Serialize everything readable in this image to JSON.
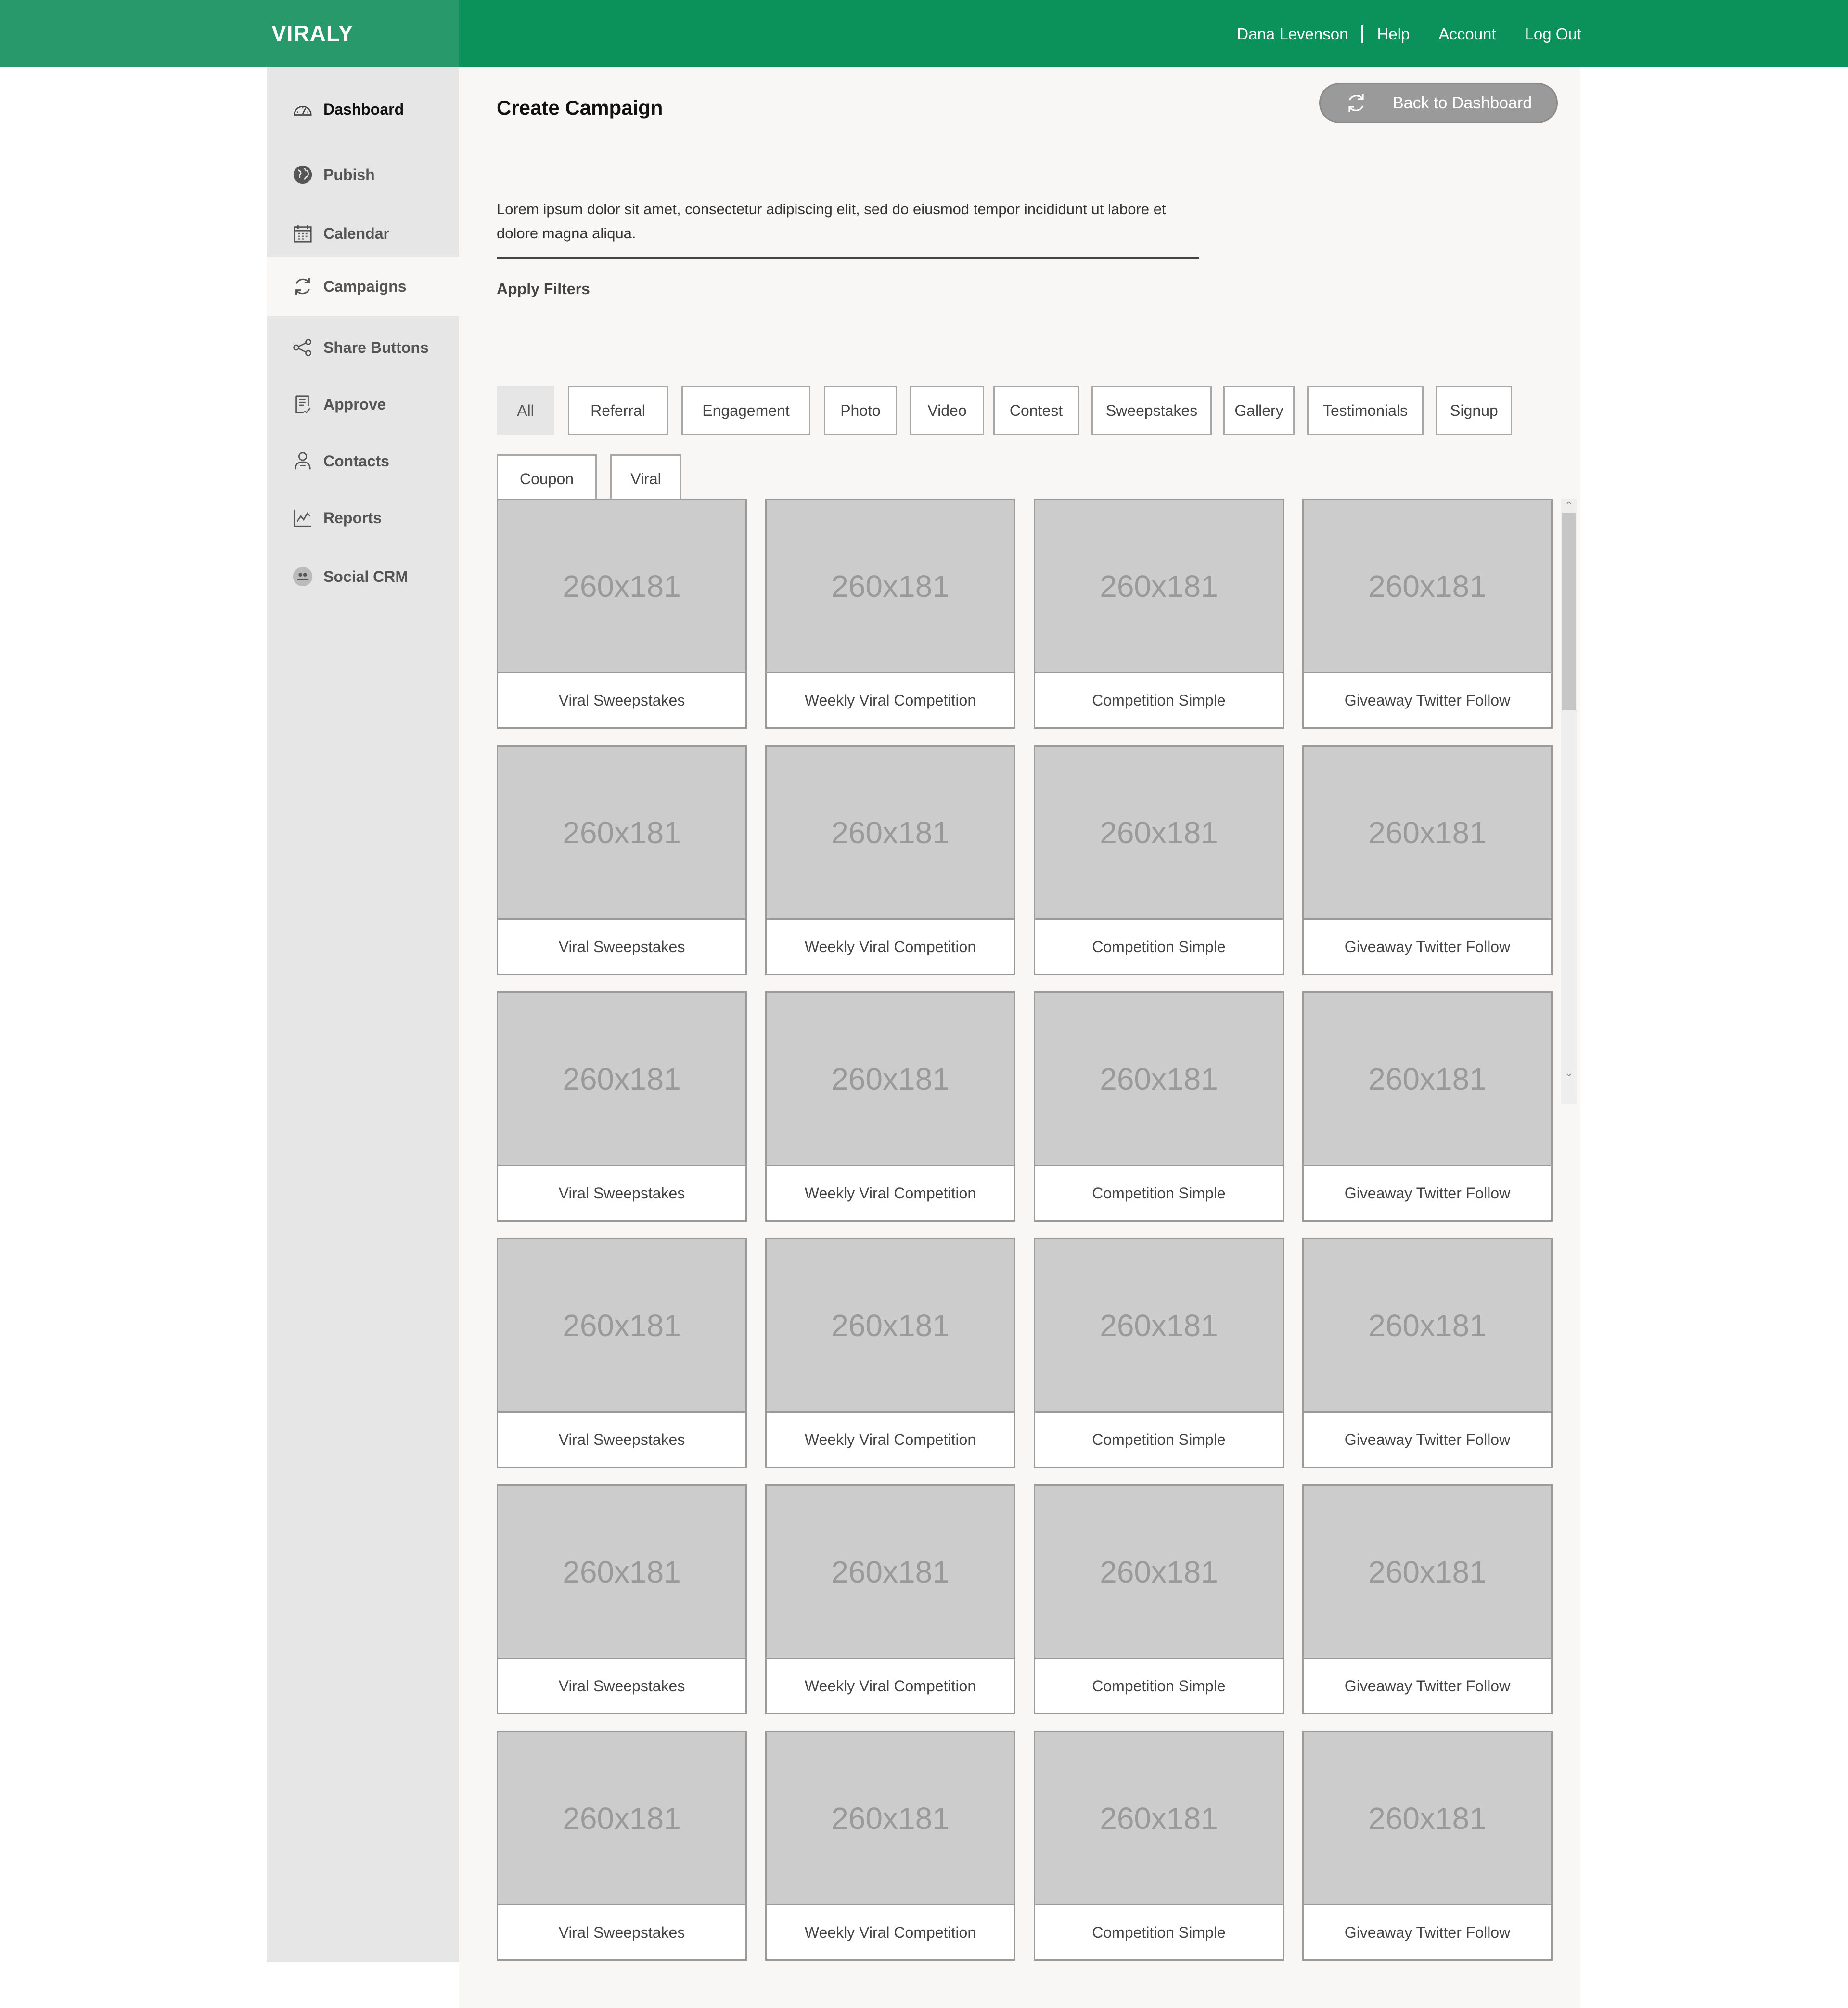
{
  "brand": "VIRALY",
  "topnav": {
    "user_name": "Dana Levenson",
    "help": "Help",
    "account": "Account",
    "logout": "Log Out"
  },
  "sidebar": {
    "items": [
      {
        "label": "Dashboard",
        "icon": "speedometer-icon"
      },
      {
        "label": "Pubish",
        "icon": "globe-icon"
      },
      {
        "label": "Calendar",
        "icon": "calendar-icon"
      },
      {
        "label": "Campaigns",
        "icon": "refresh-icon"
      },
      {
        "label": "Share Buttons",
        "icon": "share-icon"
      },
      {
        "label": "Approve",
        "icon": "document-check-icon"
      },
      {
        "label": "Contacts",
        "icon": "user-icon"
      },
      {
        "label": "Reports",
        "icon": "line-chart-icon"
      },
      {
        "label": "Social CRM",
        "icon": "people-icon"
      }
    ],
    "selected": "Campaigns"
  },
  "main": {
    "title": "Create Campaign",
    "back_button": "Back to Dashboard",
    "description": "Lorem ipsum dolor sit amet, consectetur adipiscing elit, sed do eiusmod tempor incididunt ut labore et dolore magna aliqua.",
    "filters_label": "Apply Filters",
    "filters": [
      "All",
      "Referral",
      "Engagement",
      "Photo",
      "Video",
      "Contest",
      "Sweepstakes",
      "Gallery",
      "Testimonials",
      "Signup",
      "Coupon",
      "Viral"
    ],
    "active_filter": "All",
    "placeholder_text": "260x181",
    "cards": [
      [
        "Viral Sweepstakes",
        "Weekly Viral Competition",
        "Competition Simple",
        "Giveaway Twitter Follow"
      ],
      [
        "Viral Sweepstakes",
        "Weekly Viral Competition",
        "Competition Simple",
        "Giveaway Twitter Follow"
      ],
      [
        "Viral Sweepstakes",
        "Weekly Viral Competition",
        "Competition Simple",
        "Giveaway Twitter Follow"
      ],
      [
        "Viral Sweepstakes",
        "Weekly Viral Competition",
        "Competition Simple",
        "Giveaway Twitter Follow"
      ],
      [
        "Viral Sweepstakes",
        "Weekly Viral Competition",
        "Competition Simple",
        "Giveaway Twitter Follow"
      ],
      [
        "Viral Sweepstakes",
        "Weekly Viral Competition",
        "Competition Simple",
        "Giveaway Twitter Follow"
      ]
    ]
  },
  "colors": {
    "header": "#0b915a",
    "brand_box": "#27996a",
    "sidebar": "#e6e6e6",
    "main_bg": "#f9f7f6",
    "placeholder": "#cccccc"
  }
}
